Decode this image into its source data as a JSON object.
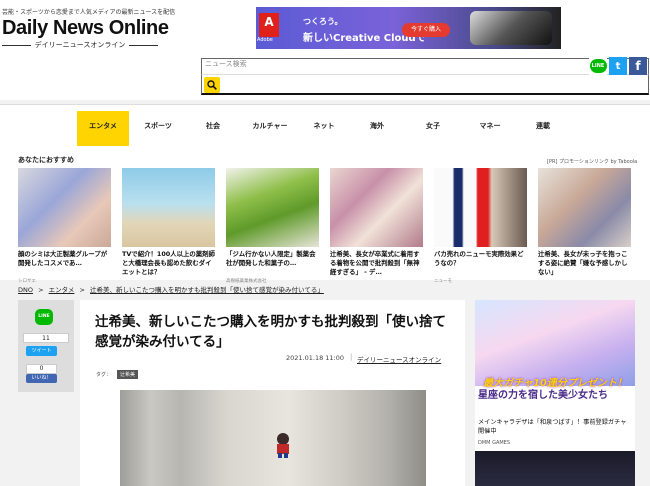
{
  "header": {
    "tagline": "芸能・スポーツから恋愛まで人気メディアの最新ニュースを配信",
    "logo": "Daily News Online",
    "logo_sub": "デイリーニュースオンライン"
  },
  "ad_banner": {
    "brand": "Adobe",
    "line1": "つくろう。",
    "line2": "新しいCreative Cloudで",
    "cta": "今すぐ購入"
  },
  "search": {
    "placeholder": "ニュース検索"
  },
  "share": {
    "line": "LINE",
    "twitter": "t",
    "facebook": "f"
  },
  "nav": {
    "items": [
      {
        "label": "エンタメ",
        "active": true
      },
      {
        "label": "スポーツ"
      },
      {
        "label": "社会"
      },
      {
        "label": "カルチャー"
      },
      {
        "label": "ネット"
      },
      {
        "label": "海外"
      },
      {
        "label": "女子"
      },
      {
        "label": "マネー"
      },
      {
        "label": "連載"
      }
    ]
  },
  "recs": {
    "title": "あなたにおすすめ",
    "sponsor": "[PR] プロモーションリンク by Taboola",
    "cards": [
      {
        "caption": "顔のシミは大正製薬グループが開発したコスメであ…",
        "source": "シロサエ"
      },
      {
        "caption": "TVで紹介！100人以上の薬剤師と大橋理会長も認めた飲むダイエットとは？",
        "source": ""
      },
      {
        "caption": "「ジム行かない人限定」製薬会社が開発した和菓子の…",
        "source": "高樹紙薬業株式会社"
      },
      {
        "caption": "辻希美、長女が卒業式に着用する着物を公開で批判殺到「無神経すぎる」 - デ…",
        "source": ""
      },
      {
        "caption": "バカ売れのニューモ実際効果どうなの？",
        "source": "ニューモ"
      },
      {
        "caption": "辻希美、長女が未っ子を抱っこする姿に絶賛「嫌な予感しかしない」",
        "source": ""
      }
    ]
  },
  "breadcrumb": {
    "home": "DNO",
    "category": "エンタメ",
    "current": "辻希美、新しいこたつ購入を明かすも批判殺到「使い捨て感覚が染み付いてる」"
  },
  "side_share": {
    "line": "LINE",
    "line_count": "11",
    "tweet": "ツイート",
    "fb_count": "0",
    "like": "いいね！"
  },
  "article": {
    "title": "辻希美、新しいこたつ購入を明かすも批判殺到「使い捨て感覚が染み付いてる」",
    "date": "2021.01.18 11:00",
    "source": "デイリーニュースオンライン",
    "tags_label": "タグ：",
    "tags": [
      "辻希美"
    ]
  },
  "right_ad": {
    "headline": "最大ガチャ10連分プレゼント！",
    "main": "星座の力を宿した美少女たち",
    "sub": "メインキャラデザは「和泉つばす」！事前登録ガチャ開催中",
    "maker": "DMM GAMES"
  },
  "colors": {
    "accent": "#ffd400",
    "line": "#00b900",
    "twitter": "#1da1f2",
    "facebook": "#3b5998"
  }
}
